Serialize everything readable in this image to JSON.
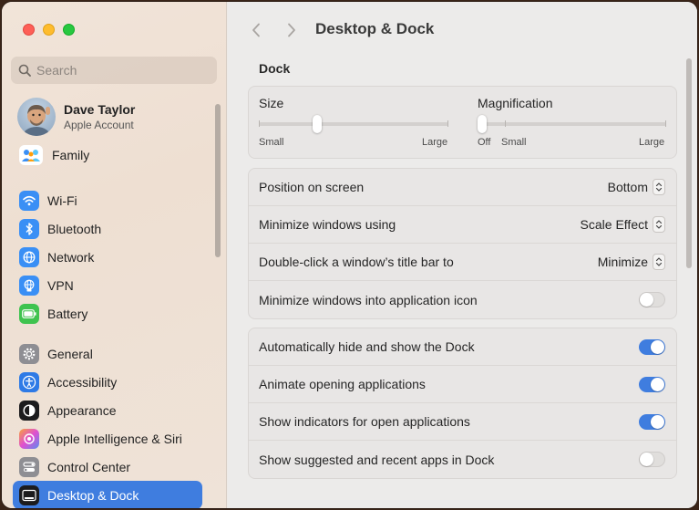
{
  "sidebar": {
    "search_placeholder": "Search",
    "account": {
      "name": "Dave Taylor",
      "subtitle": "Apple Account"
    },
    "family_label": "Family",
    "group1": [
      {
        "label": "Wi-Fi",
        "icon": "wifi-icon",
        "color": "#3a8ff5"
      },
      {
        "label": "Bluetooth",
        "icon": "bluetooth-icon",
        "color": "#3a8ff5"
      },
      {
        "label": "Network",
        "icon": "globe-icon",
        "color": "#3a8ff5"
      },
      {
        "label": "VPN",
        "icon": "vpn-globe-icon",
        "color": "#3a8ff5"
      },
      {
        "label": "Battery",
        "icon": "battery-icon",
        "color": "#3fc34f"
      }
    ],
    "group2": [
      {
        "label": "General",
        "icon": "gear-icon",
        "color": "#8e8e93"
      },
      {
        "label": "Accessibility",
        "icon": "accessibility-icon",
        "color": "#2e7ae6"
      },
      {
        "label": "Appearance",
        "icon": "appearance-icon",
        "color": "#1c1c1e"
      },
      {
        "label": "Apple Intelligence & Siri",
        "icon": "siri-icon",
        "color": "#d94bd6"
      },
      {
        "label": "Control Center",
        "icon": "control-center-icon",
        "color": "#8e8e93"
      },
      {
        "label": "Desktop & Dock",
        "icon": "dock-icon",
        "color": "#1c1c1e",
        "selected": true
      }
    ]
  },
  "main": {
    "title": "Desktop & Dock",
    "section": "Dock",
    "size_slider": {
      "title": "Size",
      "min_label": "Small",
      "max_label": "Large",
      "value": 0.3
    },
    "magnification_slider": {
      "title": "Magnification",
      "off_label": "Off",
      "min_label": "Small",
      "max_label": "Large",
      "value": 0.0
    },
    "popups": [
      {
        "label": "Position on screen",
        "value": "Bottom"
      },
      {
        "label": "Minimize windows using",
        "value": "Scale Effect"
      },
      {
        "label": "Double-click a window’s title bar to",
        "value": "Minimize"
      }
    ],
    "minimize_into_icon": {
      "label": "Minimize windows into application icon",
      "on": false
    },
    "toggles": [
      {
        "label": "Automatically hide and show the Dock",
        "on": true
      },
      {
        "label": "Animate opening applications",
        "on": true
      },
      {
        "label": "Show indicators for open applications",
        "on": true
      },
      {
        "label": "Show suggested and recent apps in Dock",
        "on": false
      }
    ]
  },
  "colors": {
    "accent": "#3f7ddf",
    "close": "#fe5f57",
    "minimize": "#febc2e",
    "zoom": "#28c840"
  }
}
